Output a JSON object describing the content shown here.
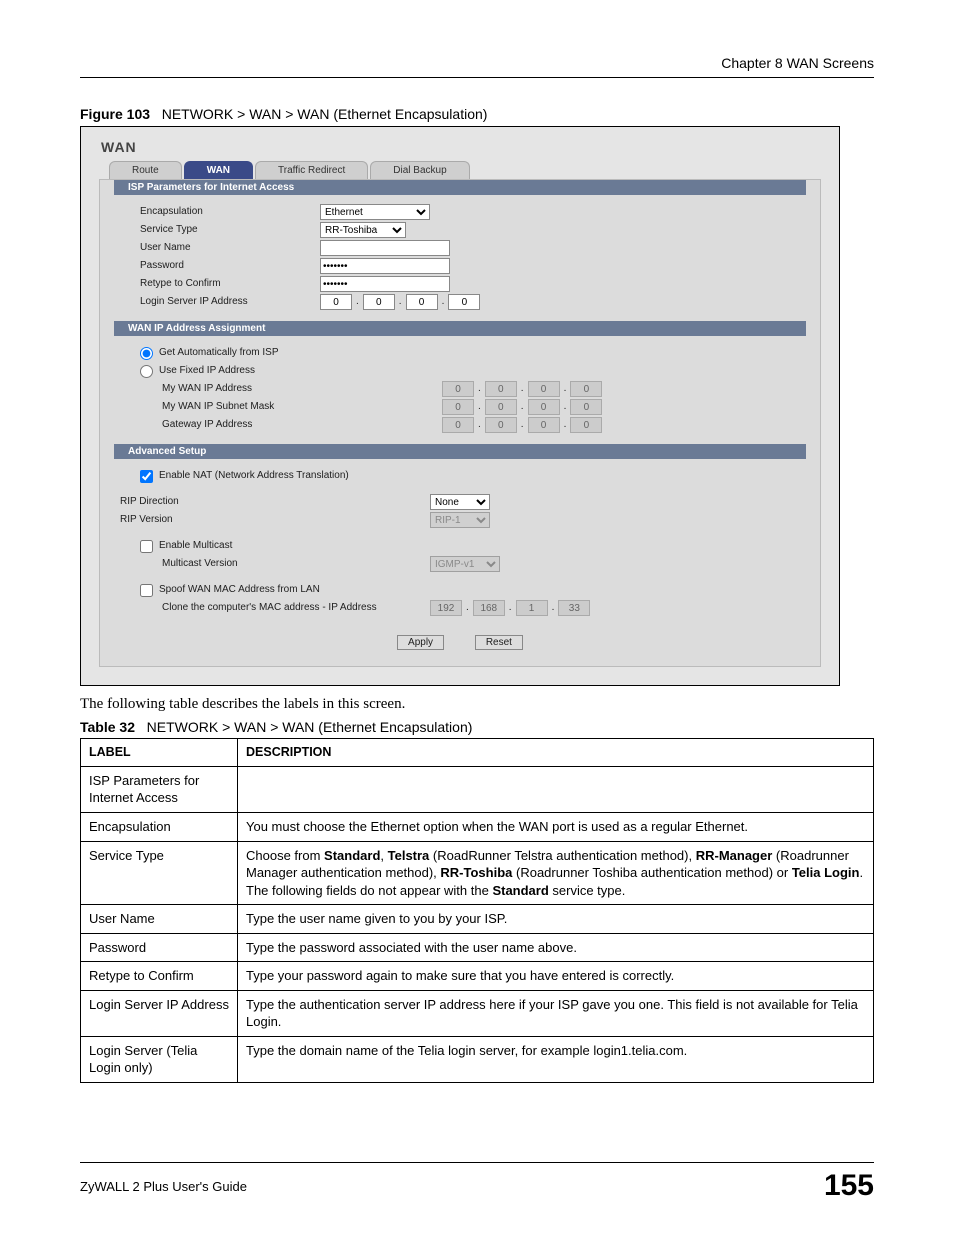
{
  "header": {
    "chapter": "Chapter 8 WAN Screens"
  },
  "figure": {
    "label": "Figure 103",
    "title": "NETWORK > WAN > WAN (Ethernet Encapsulation)"
  },
  "screenshot": {
    "title": "WAN",
    "tabs": {
      "route": "Route",
      "wan": "WAN",
      "traffic": "Traffic Redirect",
      "dial": "Dial Backup"
    },
    "section1": "ISP Parameters for Internet Access",
    "isp": {
      "encapsulation_label": "Encapsulation",
      "encapsulation_value": "Ethernet",
      "service_type_label": "Service Type",
      "service_type_value": "RR-Toshiba",
      "user_name_label": "User Name",
      "user_name_value": "",
      "password_label": "Password",
      "password_value": "xxxxxxx",
      "retype_label": "Retype to Confirm",
      "retype_value": "xxxxxxx",
      "login_server_label": "Login Server IP Address",
      "login_ip": [
        "0",
        "0",
        "0",
        "0"
      ]
    },
    "section2": "WAN IP Address Assignment",
    "wanip": {
      "auto_label": "Get Automatically from ISP",
      "fixed_label": "Use Fixed IP Address",
      "my_wan_ip_label": "My WAN IP Address",
      "my_wan_ip": [
        "0",
        "0",
        "0",
        "0"
      ],
      "subnet_label": "My WAN IP Subnet Mask",
      "subnet": [
        "0",
        "0",
        "0",
        "0"
      ],
      "gateway_label": "Gateway IP Address",
      "gateway": [
        "0",
        "0",
        "0",
        "0"
      ]
    },
    "section3": "Advanced Setup",
    "adv": {
      "nat_label": "Enable NAT (Network Address Translation)",
      "rip_dir_label": "RIP Direction",
      "rip_dir_value": "None",
      "rip_ver_label": "RIP Version",
      "rip_ver_value": "RIP-1",
      "multicast_label": "Enable Multicast",
      "multicast_ver_label": "Multicast Version",
      "multicast_ver_value": "IGMP-v1",
      "spoof_label": "Spoof WAN MAC Address from LAN",
      "clone_label": "Clone the computer's MAC address - IP Address",
      "clone_ip": [
        "192",
        "168",
        "1",
        "33"
      ]
    },
    "buttons": {
      "apply": "Apply",
      "reset": "Reset"
    }
  },
  "following_text": "The following table describes the labels in this screen.",
  "table_caption": {
    "label": "Table 32",
    "title": "NETWORK > WAN > WAN (Ethernet Encapsulation)"
  },
  "table": {
    "headers": {
      "label": "Label",
      "desc": "Description"
    },
    "rows": [
      {
        "label": "ISP Parameters for Internet Access",
        "desc": ""
      },
      {
        "label": "Encapsulation",
        "desc": "You must choose the Ethernet option when the WAN port is used as a regular Ethernet."
      },
      {
        "label": "Service Type",
        "desc_html": "Choose from <b>Standard</b>, <b>Telstra</b> (RoadRunner Telstra authentication method), <b>RR-Manager</b> (Roadrunner Manager authentication method), <b>RR-Toshiba</b> (Roadrunner Toshiba authentication method) or <b>Telia Login</b>.<br>The following fields do not appear with the <b>Standard</b> service type."
      },
      {
        "label": "User Name",
        "desc": "Type the user name given to you by your ISP."
      },
      {
        "label": "Password",
        "desc": "Type the password associated with the user name above."
      },
      {
        "label": "Retype to Confirm",
        "desc": "Type your password again to make sure that you have entered is correctly."
      },
      {
        "label": "Login Server IP Address",
        "desc": "Type the authentication server IP address here if your ISP gave you one. This field is not available for Telia Login."
      },
      {
        "label": "Login Server (Telia Login only)",
        "desc": "Type the domain name of the Telia login server, for example login1.telia.com."
      }
    ]
  },
  "footer": {
    "guide": "ZyWALL 2 Plus User's Guide",
    "page": "155"
  }
}
